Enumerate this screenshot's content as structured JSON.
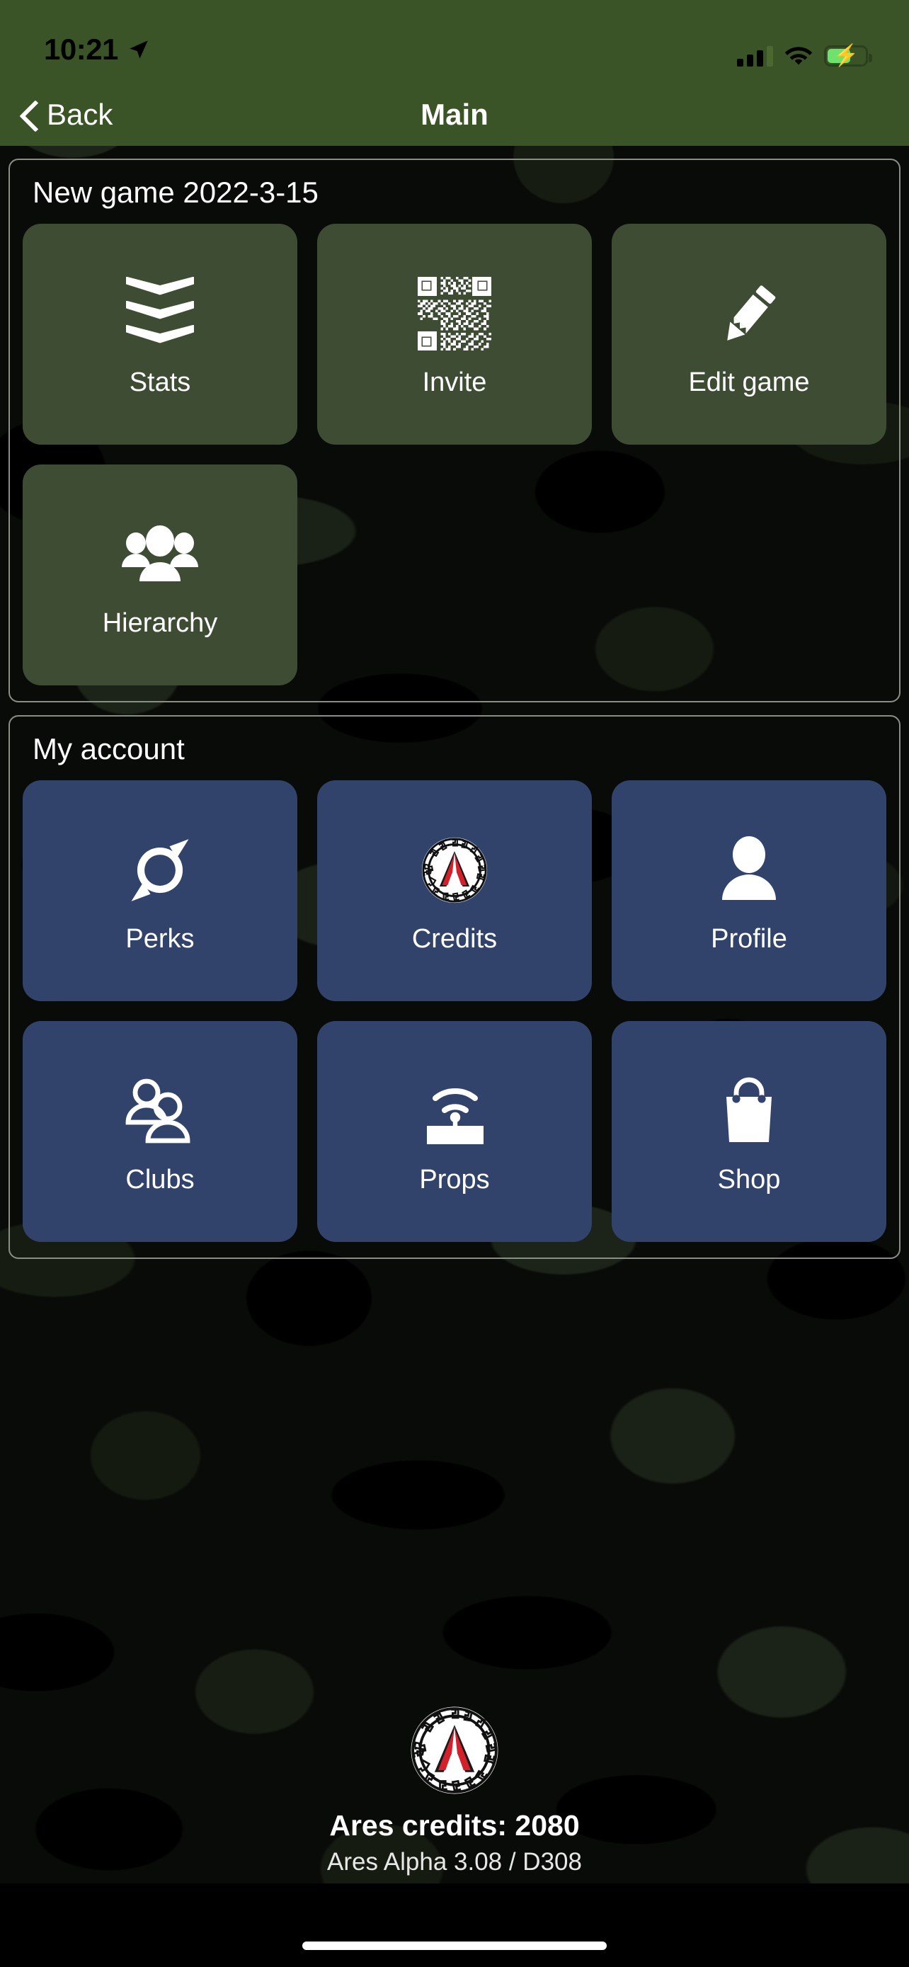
{
  "status_bar": {
    "time": "10:21",
    "location_icon": "location-arrow-icon",
    "signal_icon": "cellular-signal-icon",
    "wifi_icon": "wifi-icon",
    "battery_icon": "battery-charging-icon"
  },
  "nav": {
    "back_label": "Back",
    "back_icon": "chevron-left-icon",
    "title": "Main"
  },
  "groups": [
    {
      "title": "New game 2022-3-15",
      "style": "green",
      "tiles": [
        {
          "label": "Stats",
          "icon": "rank-chevrons-icon"
        },
        {
          "label": "Invite",
          "icon": "qr-code-icon"
        },
        {
          "label": "Edit game",
          "icon": "pencil-icon"
        },
        {
          "label": "Hierarchy",
          "icon": "group-people-icon"
        }
      ]
    },
    {
      "title": "My account",
      "style": "blue",
      "tiles": [
        {
          "label": "Perks",
          "icon": "perks-swirl-icon"
        },
        {
          "label": "Credits",
          "icon": "ares-logo-icon"
        },
        {
          "label": "Profile",
          "icon": "person-icon"
        },
        {
          "label": "Clubs",
          "icon": "two-people-outline-icon"
        },
        {
          "label": "Props",
          "icon": "beacon-antenna-icon"
        },
        {
          "label": "Shop",
          "icon": "shopping-bag-icon"
        }
      ]
    }
  ],
  "footer": {
    "logo_icon": "ares-logo-icon",
    "credits": "Ares credits: 2080",
    "version": "Ares Alpha 3.08 / D308"
  },
  "colors": {
    "status_bar_green": "#3b5427",
    "tile_green": "#3e4c33",
    "tile_blue": "#32436b",
    "logo_red": "#d4202a",
    "background_black": "#090b08"
  }
}
